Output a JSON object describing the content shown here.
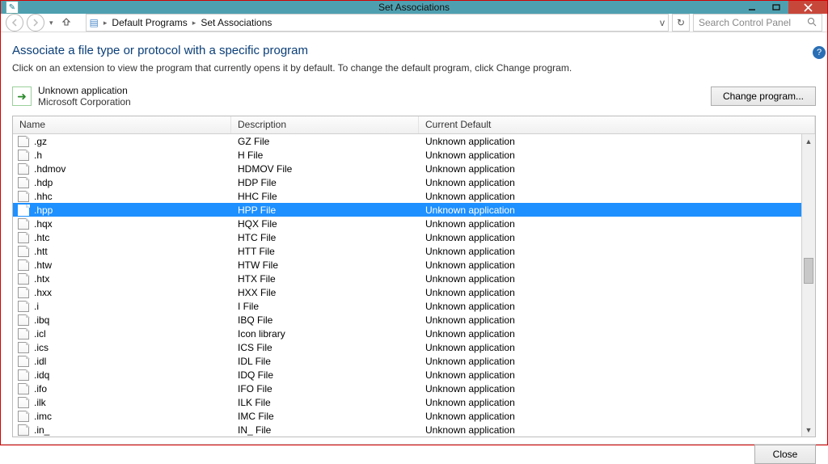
{
  "window": {
    "title": "Set Associations",
    "sys_icon_label": "✎"
  },
  "nav": {
    "breadcrumb_icon": "▤",
    "crumb1": "Default Programs",
    "crumb2": "Set Associations",
    "address_dropdown_glyph": "v",
    "refresh_glyph": "↻",
    "search_placeholder": "Search Control Panel"
  },
  "page": {
    "heading": "Associate a file type or protocol with a specific program",
    "subtext": "Click on an extension to view the program that currently opens it by default. To change the default program, click Change program.",
    "selected_app_name": "Unknown application",
    "selected_app_vendor": "Microsoft Corporation",
    "change_program_label": "Change program...",
    "help_glyph": "?"
  },
  "table": {
    "col_name": "Name",
    "col_desc": "Description",
    "col_def": "Current Default",
    "selected_ext": ".hpp",
    "rows": [
      {
        "ext": ".gz",
        "desc": "GZ File",
        "def": "Unknown application"
      },
      {
        "ext": ".h",
        "desc": "H File",
        "def": "Unknown application"
      },
      {
        "ext": ".hdmov",
        "desc": "HDMOV File",
        "def": "Unknown application"
      },
      {
        "ext": ".hdp",
        "desc": "HDP File",
        "def": "Unknown application"
      },
      {
        "ext": ".hhc",
        "desc": "HHC File",
        "def": "Unknown application"
      },
      {
        "ext": ".hpp",
        "desc": "HPP File",
        "def": "Unknown application"
      },
      {
        "ext": ".hqx",
        "desc": "HQX File",
        "def": "Unknown application"
      },
      {
        "ext": ".htc",
        "desc": "HTC File",
        "def": "Unknown application"
      },
      {
        "ext": ".htt",
        "desc": "HTT File",
        "def": "Unknown application"
      },
      {
        "ext": ".htw",
        "desc": "HTW File",
        "def": "Unknown application"
      },
      {
        "ext": ".htx",
        "desc": "HTX File",
        "def": "Unknown application"
      },
      {
        "ext": ".hxx",
        "desc": "HXX File",
        "def": "Unknown application"
      },
      {
        "ext": ".i",
        "desc": "I File",
        "def": "Unknown application"
      },
      {
        "ext": ".ibq",
        "desc": "IBQ File",
        "def": "Unknown application"
      },
      {
        "ext": ".icl",
        "desc": "Icon library",
        "def": "Unknown application"
      },
      {
        "ext": ".ics",
        "desc": "ICS File",
        "def": "Unknown application"
      },
      {
        "ext": ".idl",
        "desc": "IDL File",
        "def": "Unknown application"
      },
      {
        "ext": ".idq",
        "desc": "IDQ File",
        "def": "Unknown application"
      },
      {
        "ext": ".ifo",
        "desc": "IFO File",
        "def": "Unknown application"
      },
      {
        "ext": ".ilk",
        "desc": "ILK File",
        "def": "Unknown application"
      },
      {
        "ext": ".imc",
        "desc": "IMC File",
        "def": "Unknown application"
      },
      {
        "ext": ".in_",
        "desc": "IN_ File",
        "def": "Unknown application"
      }
    ]
  },
  "footer": {
    "close_label": "Close"
  }
}
